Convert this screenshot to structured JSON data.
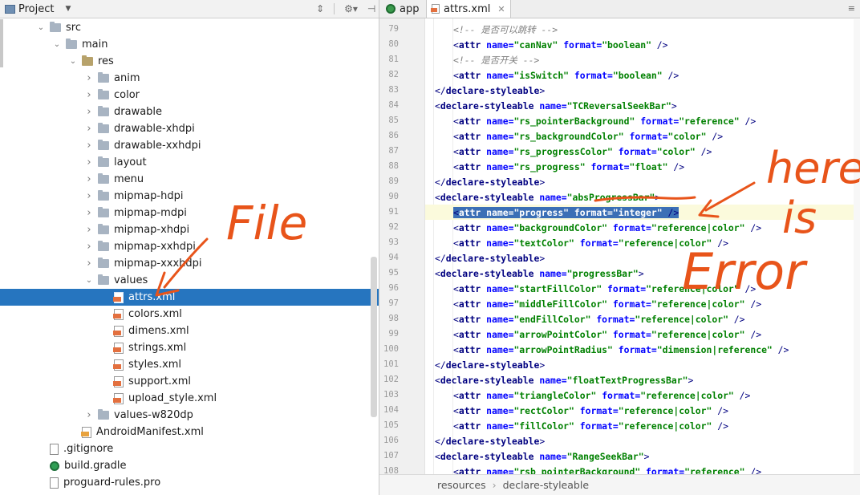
{
  "project_panel": {
    "title": "Project",
    "tree": [
      {
        "label": "src",
        "type": "folder",
        "indent": 0,
        "expanded": true
      },
      {
        "label": "main",
        "type": "folder",
        "indent": 1,
        "expanded": true
      },
      {
        "label": "res",
        "type": "res-folder",
        "indent": 2,
        "expanded": true
      },
      {
        "label": "anim",
        "type": "folder",
        "indent": 3,
        "expanded": false
      },
      {
        "label": "color",
        "type": "folder",
        "indent": 3,
        "expanded": false
      },
      {
        "label": "drawable",
        "type": "folder",
        "indent": 3,
        "expanded": false
      },
      {
        "label": "drawable-xhdpi",
        "type": "folder",
        "indent": 3,
        "expanded": false
      },
      {
        "label": "drawable-xxhdpi",
        "type": "folder",
        "indent": 3,
        "expanded": false
      },
      {
        "label": "layout",
        "type": "folder",
        "indent": 3,
        "expanded": false
      },
      {
        "label": "menu",
        "type": "folder",
        "indent": 3,
        "expanded": false
      },
      {
        "label": "mipmap-hdpi",
        "type": "folder",
        "indent": 3,
        "expanded": false
      },
      {
        "label": "mipmap-mdpi",
        "type": "folder",
        "indent": 3,
        "expanded": false
      },
      {
        "label": "mipmap-xhdpi",
        "type": "folder",
        "indent": 3,
        "expanded": false
      },
      {
        "label": "mipmap-xxhdpi",
        "type": "folder",
        "indent": 3,
        "expanded": false
      },
      {
        "label": "mipmap-xxxhdpi",
        "type": "folder",
        "indent": 3,
        "expanded": false
      },
      {
        "label": "values",
        "type": "folder",
        "indent": 3,
        "expanded": true
      },
      {
        "label": "attrs.xml",
        "type": "xml",
        "indent": 4,
        "selected": true
      },
      {
        "label": "colors.xml",
        "type": "xml",
        "indent": 4
      },
      {
        "label": "dimens.xml",
        "type": "xml",
        "indent": 4
      },
      {
        "label": "strings.xml",
        "type": "xml",
        "indent": 4
      },
      {
        "label": "styles.xml",
        "type": "xml",
        "indent": 4
      },
      {
        "label": "support.xml",
        "type": "xml",
        "indent": 4
      },
      {
        "label": "upload_style.xml",
        "type": "xml",
        "indent": 4
      },
      {
        "label": "values-w820dp",
        "type": "folder",
        "indent": 3,
        "expanded": false
      },
      {
        "label": "AndroidManifest.xml",
        "type": "manifest",
        "indent": 2
      },
      {
        "label": ".gitignore",
        "type": "file",
        "indent": 0
      },
      {
        "label": "build.gradle",
        "type": "gradle",
        "indent": 0
      },
      {
        "label": "proguard-rules.pro",
        "type": "file",
        "indent": 0
      }
    ]
  },
  "editor": {
    "tabs": [
      {
        "label": "app",
        "icon": "android-module-icon",
        "active": false
      },
      {
        "label": "attrs.xml",
        "icon": "xml-file-icon",
        "active": true
      }
    ],
    "caret_line": 91,
    "selected_line": 91,
    "lines": [
      {
        "n": 79,
        "indent": 3,
        "tokens": [
          [
            "cm",
            "<!-- 是否可以跳转 -->"
          ]
        ]
      },
      {
        "n": 80,
        "indent": 3,
        "tokens": [
          [
            "pn",
            "<"
          ],
          [
            "tg",
            "attr "
          ],
          [
            "an",
            "name="
          ],
          [
            "av",
            "\"canNav\" "
          ],
          [
            "an",
            "format="
          ],
          [
            "av",
            "\"boolean\" "
          ],
          [
            "pn",
            "/>"
          ]
        ]
      },
      {
        "n": 81,
        "indent": 3,
        "tokens": [
          [
            "cm",
            "<!-- 是否开关 -->"
          ]
        ]
      },
      {
        "n": 82,
        "indent": 3,
        "tokens": [
          [
            "pn",
            "<"
          ],
          [
            "tg",
            "attr "
          ],
          [
            "an",
            "name="
          ],
          [
            "av",
            "\"isSwitch\" "
          ],
          [
            "an",
            "format="
          ],
          [
            "av",
            "\"boolean\" "
          ],
          [
            "pn",
            "/>"
          ]
        ]
      },
      {
        "n": 83,
        "indent": 2,
        "fold": true,
        "tokens": [
          [
            "pn",
            "</"
          ],
          [
            "tg",
            "declare-styleable"
          ],
          [
            "pn",
            ">"
          ]
        ]
      },
      {
        "n": 84,
        "indent": 2,
        "fold": true,
        "tokens": [
          [
            "pn",
            "<"
          ],
          [
            "tg",
            "declare-styleable "
          ],
          [
            "an",
            "name="
          ],
          [
            "av",
            "\"TCReversalSeekBar\""
          ],
          [
            "pn",
            ">"
          ]
        ]
      },
      {
        "n": 85,
        "indent": 3,
        "tokens": [
          [
            "pn",
            "<"
          ],
          [
            "tg",
            "attr "
          ],
          [
            "an",
            "name="
          ],
          [
            "av",
            "\"rs_pointerBackground\" "
          ],
          [
            "an",
            "format="
          ],
          [
            "av",
            "\"reference\" "
          ],
          [
            "pn",
            "/>"
          ]
        ]
      },
      {
        "n": 86,
        "indent": 3,
        "tokens": [
          [
            "pn",
            "<"
          ],
          [
            "tg",
            "attr "
          ],
          [
            "an",
            "name="
          ],
          [
            "av",
            "\"rs_backgroundColor\" "
          ],
          [
            "an",
            "format="
          ],
          [
            "av",
            "\"color\" "
          ],
          [
            "pn",
            "/>"
          ]
        ]
      },
      {
        "n": 87,
        "indent": 3,
        "tokens": [
          [
            "pn",
            "<"
          ],
          [
            "tg",
            "attr "
          ],
          [
            "an",
            "name="
          ],
          [
            "av",
            "\"rs_progressColor\" "
          ],
          [
            "an",
            "format="
          ],
          [
            "av",
            "\"color\" "
          ],
          [
            "pn",
            "/>"
          ]
        ]
      },
      {
        "n": 88,
        "indent": 3,
        "tokens": [
          [
            "pn",
            "<"
          ],
          [
            "tg",
            "attr "
          ],
          [
            "an",
            "name="
          ],
          [
            "av",
            "\"rs_progress\" "
          ],
          [
            "an",
            "format="
          ],
          [
            "av",
            "\"float\" "
          ],
          [
            "pn",
            "/>"
          ]
        ]
      },
      {
        "n": 89,
        "indent": 2,
        "fold": true,
        "tokens": [
          [
            "pn",
            "</"
          ],
          [
            "tg",
            "declare-styleable"
          ],
          [
            "pn",
            ">"
          ]
        ]
      },
      {
        "n": 90,
        "indent": 2,
        "fold": true,
        "tokens": [
          [
            "pn",
            "<"
          ],
          [
            "tg",
            "declare-styleable "
          ],
          [
            "an",
            "name="
          ],
          [
            "av",
            "\"absProgressBar\""
          ],
          [
            "pn",
            ">"
          ]
        ]
      },
      {
        "n": 91,
        "indent": 3,
        "selected": true,
        "tokens": [
          [
            "pn",
            "<"
          ],
          [
            "tg",
            "attr "
          ],
          [
            "an",
            "name="
          ],
          [
            "av",
            "\"progress\" "
          ],
          [
            "an",
            "format="
          ],
          [
            "av",
            "\"integer\" "
          ],
          [
            "pn",
            "/>"
          ]
        ]
      },
      {
        "n": 92,
        "indent": 3,
        "tokens": [
          [
            "pn",
            "<"
          ],
          [
            "tg",
            "attr "
          ],
          [
            "an",
            "name="
          ],
          [
            "av",
            "\"backgroundColor\" "
          ],
          [
            "an",
            "format="
          ],
          [
            "av",
            "\"reference|color\" "
          ],
          [
            "pn",
            "/>"
          ]
        ]
      },
      {
        "n": 93,
        "indent": 3,
        "tokens": [
          [
            "pn",
            "<"
          ],
          [
            "tg",
            "attr "
          ],
          [
            "an",
            "name="
          ],
          [
            "av",
            "\"textColor\" "
          ],
          [
            "an",
            "format="
          ],
          [
            "av",
            "\"reference|color\" "
          ],
          [
            "pn",
            "/>"
          ]
        ]
      },
      {
        "n": 94,
        "indent": 2,
        "fold": true,
        "tokens": [
          [
            "pn",
            "</"
          ],
          [
            "tg",
            "declare-styleable"
          ],
          [
            "pn",
            ">"
          ]
        ]
      },
      {
        "n": 95,
        "indent": 2,
        "fold": true,
        "tokens": [
          [
            "pn",
            "<"
          ],
          [
            "tg",
            "declare-styleable "
          ],
          [
            "an",
            "name="
          ],
          [
            "av",
            "\"progressBar\""
          ],
          [
            "pn",
            ">"
          ]
        ]
      },
      {
        "n": 96,
        "indent": 3,
        "tokens": [
          [
            "pn",
            "<"
          ],
          [
            "tg",
            "attr "
          ],
          [
            "an",
            "name="
          ],
          [
            "av",
            "\"startFillColor\" "
          ],
          [
            "an",
            "format="
          ],
          [
            "av",
            "\"reference|color\" "
          ],
          [
            "pn",
            "/>"
          ]
        ]
      },
      {
        "n": 97,
        "indent": 3,
        "tokens": [
          [
            "pn",
            "<"
          ],
          [
            "tg",
            "attr "
          ],
          [
            "an",
            "name="
          ],
          [
            "av",
            "\"middleFillColor\" "
          ],
          [
            "an",
            "format="
          ],
          [
            "av",
            "\"reference|color\" "
          ],
          [
            "pn",
            "/>"
          ]
        ]
      },
      {
        "n": 98,
        "indent": 3,
        "tokens": [
          [
            "pn",
            "<"
          ],
          [
            "tg",
            "attr "
          ],
          [
            "an",
            "name="
          ],
          [
            "av",
            "\"endFillColor\" "
          ],
          [
            "an",
            "format="
          ],
          [
            "av",
            "\"reference|color\" "
          ],
          [
            "pn",
            "/>"
          ]
        ]
      },
      {
        "n": 99,
        "indent": 3,
        "tokens": [
          [
            "pn",
            "<"
          ],
          [
            "tg",
            "attr "
          ],
          [
            "an",
            "name="
          ],
          [
            "av",
            "\"arrowPointColor\" "
          ],
          [
            "an",
            "format="
          ],
          [
            "av",
            "\"reference|color\" "
          ],
          [
            "pn",
            "/>"
          ]
        ]
      },
      {
        "n": 100,
        "indent": 3,
        "tokens": [
          [
            "pn",
            "<"
          ],
          [
            "tg",
            "attr "
          ],
          [
            "an",
            "name="
          ],
          [
            "av",
            "\"arrowPointRadius\" "
          ],
          [
            "an",
            "format="
          ],
          [
            "av",
            "\"dimension|reference\" "
          ],
          [
            "pn",
            "/>"
          ]
        ]
      },
      {
        "n": 101,
        "indent": 2,
        "fold": true,
        "tokens": [
          [
            "pn",
            "</"
          ],
          [
            "tg",
            "declare-styleable"
          ],
          [
            "pn",
            ">"
          ]
        ]
      },
      {
        "n": 102,
        "indent": 2,
        "fold": true,
        "tokens": [
          [
            "pn",
            "<"
          ],
          [
            "tg",
            "declare-styleable "
          ],
          [
            "an",
            "name="
          ],
          [
            "av",
            "\"floatTextProgressBar\""
          ],
          [
            "pn",
            ">"
          ]
        ]
      },
      {
        "n": 103,
        "indent": 3,
        "tokens": [
          [
            "pn",
            "<"
          ],
          [
            "tg",
            "attr "
          ],
          [
            "an",
            "name="
          ],
          [
            "av",
            "\"triangleColor\" "
          ],
          [
            "an",
            "format="
          ],
          [
            "av",
            "\"reference|color\" "
          ],
          [
            "pn",
            "/>"
          ]
        ]
      },
      {
        "n": 104,
        "indent": 3,
        "tokens": [
          [
            "pn",
            "<"
          ],
          [
            "tg",
            "attr "
          ],
          [
            "an",
            "name="
          ],
          [
            "av",
            "\"rectColor\" "
          ],
          [
            "an",
            "format="
          ],
          [
            "av",
            "\"reference|color\" "
          ],
          [
            "pn",
            "/>"
          ]
        ]
      },
      {
        "n": 105,
        "indent": 3,
        "tokens": [
          [
            "pn",
            "<"
          ],
          [
            "tg",
            "attr "
          ],
          [
            "an",
            "name="
          ],
          [
            "av",
            "\"fillColor\" "
          ],
          [
            "an",
            "format="
          ],
          [
            "av",
            "\"reference|color\" "
          ],
          [
            "pn",
            "/>"
          ]
        ]
      },
      {
        "n": 106,
        "indent": 2,
        "fold": true,
        "tokens": [
          [
            "pn",
            "</"
          ],
          [
            "tg",
            "declare-styleable"
          ],
          [
            "pn",
            ">"
          ]
        ]
      },
      {
        "n": 107,
        "indent": 2,
        "fold": true,
        "tokens": [
          [
            "pn",
            "<"
          ],
          [
            "tg",
            "declare-styleable "
          ],
          [
            "an",
            "name="
          ],
          [
            "av",
            "\"RangeSeekBar\""
          ],
          [
            "pn",
            ">"
          ]
        ]
      },
      {
        "n": 108,
        "indent": 3,
        "tokens": [
          [
            "pn",
            "<"
          ],
          [
            "tg",
            "attr "
          ],
          [
            "an",
            "name="
          ],
          [
            "av",
            "\"rsb_pointerBackground\" "
          ],
          [
            "an",
            "format="
          ],
          [
            "av",
            "\"reference\" "
          ],
          [
            "pn",
            "/>"
          ]
        ]
      }
    ],
    "breadcrumb": [
      "resources",
      "declare-styleable"
    ]
  },
  "annotations": {
    "left_note": "File",
    "right_note_line1": "here",
    "right_note_line2": "is",
    "right_note_line3": "Error",
    "ink_color": "#e8541a"
  },
  "colors": {
    "selection_blue": "#2675bf",
    "code_selection": "#3b6fb6",
    "tag": "#000080",
    "attr_name": "#0000ff",
    "attr_value": "#008000"
  }
}
